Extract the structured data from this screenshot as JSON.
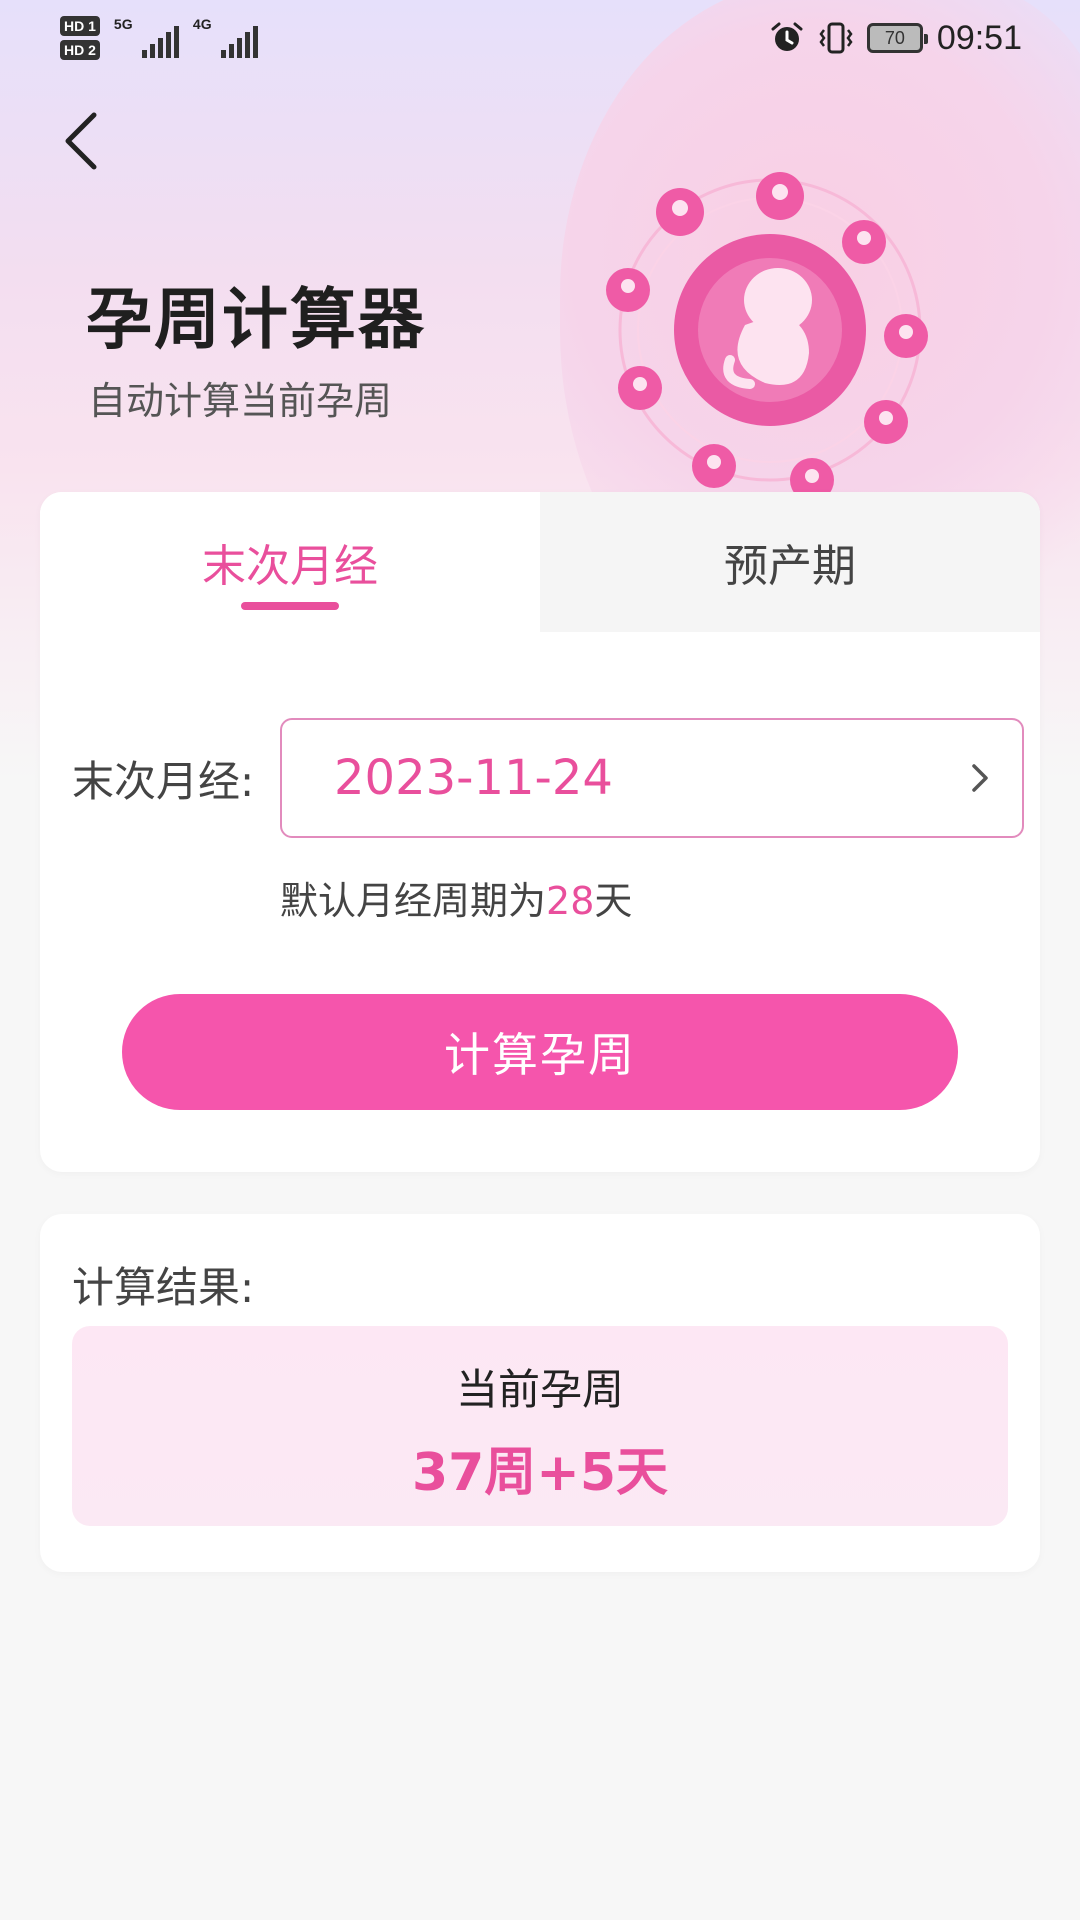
{
  "status_bar": {
    "hd1": "HD 1",
    "hd2": "HD 2",
    "net1": "5G",
    "net2": "4G",
    "battery": "70",
    "time": "09:51",
    "icons": [
      "alarm-icon",
      "vibrate-icon",
      "battery-icon"
    ]
  },
  "header": {
    "title": "孕周计算器",
    "subtitle": "自动计算当前孕周"
  },
  "tabs": [
    {
      "label": "末次月经",
      "active": true
    },
    {
      "label": "预产期",
      "active": false
    }
  ],
  "form": {
    "label": "末次月经:",
    "date_value": "2023-11-24",
    "hint_prefix": "默认月经周期为",
    "hint_number": "28",
    "hint_suffix": "天"
  },
  "calc_button": "计算孕周",
  "result": {
    "label": "计算结果:",
    "title": "当前孕周",
    "value": "37周+5天"
  },
  "colors": {
    "accent": "#e94f9c",
    "button": "#f555ac",
    "result_bg": "#fde7f4"
  }
}
